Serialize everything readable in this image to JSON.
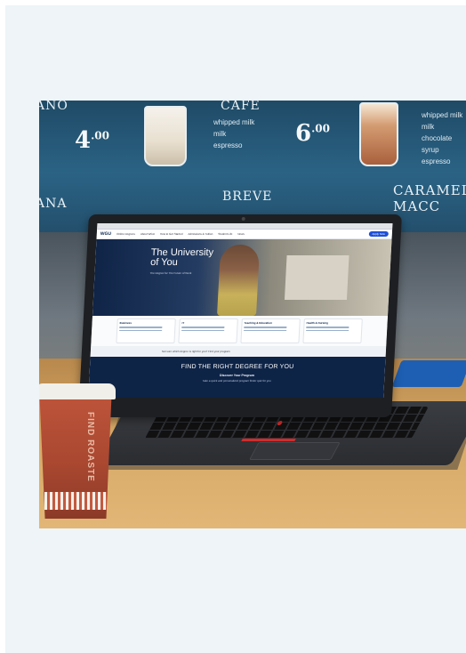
{
  "menu_board": {
    "top_left_word": "ANO",
    "price_left": "4",
    "price_left_cents": ".00",
    "list_left": [
      "whipped milk",
      "milk",
      "espresso"
    ],
    "brand_word_top": "CAFE",
    "price_mid": "6",
    "price_mid_cents": ".00",
    "list_right": [
      "whipped milk",
      "milk",
      "chocolate syrup",
      "espresso"
    ],
    "word_left_bottom": "ANA",
    "word_mid_bottom": "BREVE",
    "word_right_bottom": "CARAMEL MACC"
  },
  "laptop_screen": {
    "logo": "WGU",
    "nav_items": [
      "Online Degrees",
      "About WGU",
      "How to Get Started",
      "Admissions & Tuition",
      "Student Life",
      "News"
    ],
    "apply_label": "Apply Now",
    "hero_title_line1": "The University",
    "hero_title_line2": "of You",
    "hero_subtitle": "The Degree for The Future of Work",
    "cards": [
      "Business",
      "IT",
      "Teaching & Education",
      "Health & Nursing"
    ],
    "mid_text": "Not sure which degree is right for you? Find your program",
    "find_title": "FIND THE RIGHT DEGREE FOR YOU",
    "find_subtitle": "Discover Your Program",
    "find_note": "Take a quick and personalized program finder quiz for you"
  },
  "coffee_cup": {
    "print_text": "FIND ROASTE"
  }
}
